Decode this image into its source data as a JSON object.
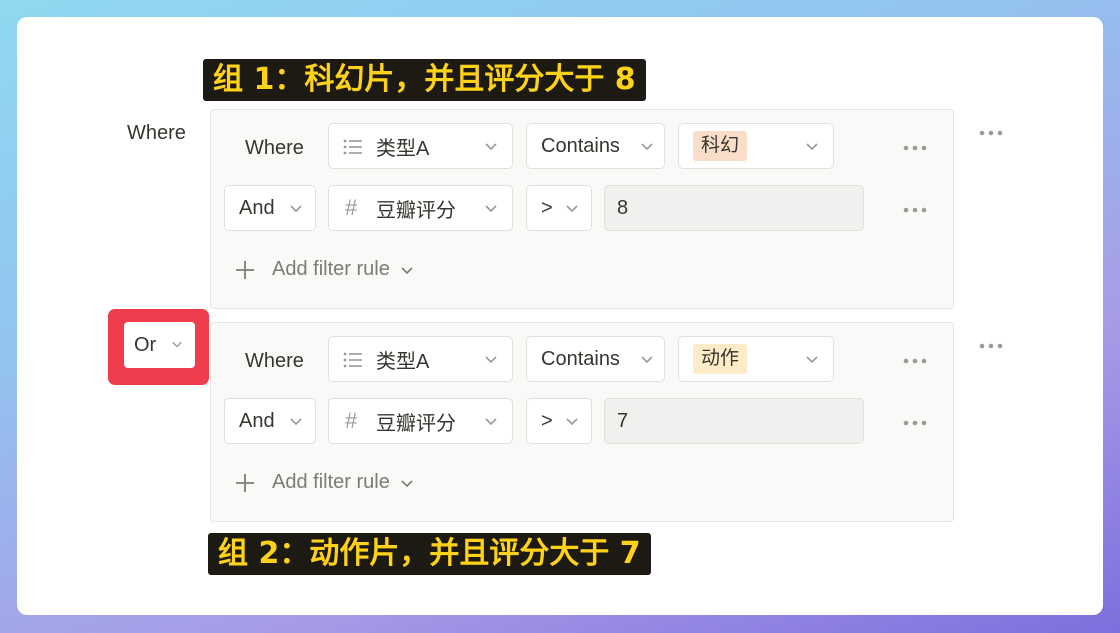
{
  "annotations": {
    "group1": "组 1：科幻片，并且评分大于 8",
    "group2": "组 2：动作片，并且评分大于 7"
  },
  "top_where_label": "Where",
  "or_selector": {
    "label": "Or"
  },
  "groups": [
    {
      "rows": [
        {
          "connector": "Where",
          "property": "类型A",
          "operator": "Contains",
          "value": "科幻",
          "value_color": "#fadec9"
        },
        {
          "connector": "And",
          "property": "豆瓣评分",
          "operator": ">",
          "value": "8"
        }
      ],
      "add_rule_label": "Add filter rule"
    },
    {
      "rows": [
        {
          "connector": "Where",
          "property": "类型A",
          "operator": "Contains",
          "value": "动作",
          "value_color": "#fdecc8"
        },
        {
          "connector": "And",
          "property": "豆瓣评分",
          "operator": ">",
          "value": "7"
        }
      ],
      "add_rule_label": "Add filter rule"
    }
  ],
  "colors": {
    "highlight_border": "#f03d4e",
    "caption_text": "#ffd21a",
    "caption_bg": "#1c1a12"
  }
}
